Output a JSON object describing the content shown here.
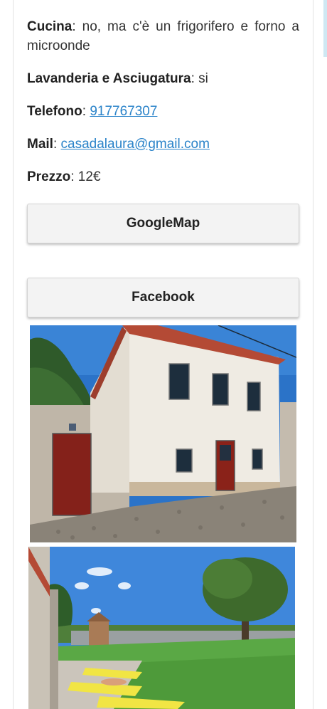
{
  "details": {
    "cucina_label": "Cucina",
    "cucina_value": ": no, ma c'è un frigorifero e forno a microonde",
    "lavanderia_label": "Lavanderia e Asciugatura",
    "lavanderia_value": ": si",
    "telefono_label": "Telefono",
    "telefono_sep": ": ",
    "telefono_value": "917767307",
    "mail_label": "Mail",
    "mail_sep": ": ",
    "mail_value": "casadalaura@gmail.com",
    "prezzo_label": "Prezzo",
    "prezzo_value": ": 12€"
  },
  "buttons": {
    "googlemap_label": "GoogleMap",
    "facebook_label": "Facebook"
  },
  "colors": {
    "link": "#2a83c9",
    "button_bg": "#f3f3f3",
    "sky": "#2b73c8"
  },
  "photos": {
    "photo1_icon": "house-photo",
    "photo2_icon": "garden-photo"
  }
}
